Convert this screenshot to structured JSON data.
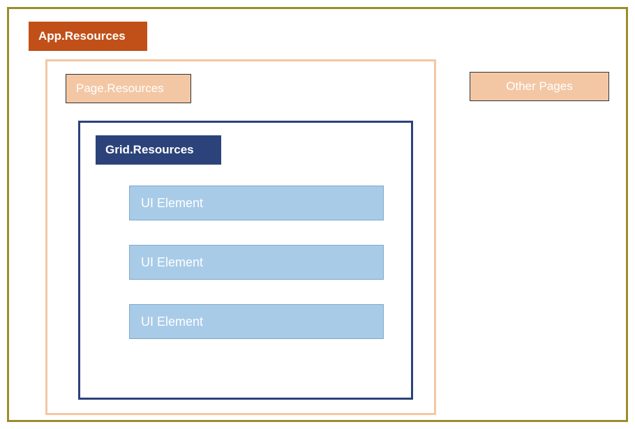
{
  "diagram": {
    "app_resources_label": "App.Resources",
    "page_resources_label": "Page.Resources",
    "other_pages_label": "Other Pages",
    "grid_resources_label": "Grid.Resources",
    "ui_elements": [
      "UI Element",
      "UI Element",
      "UI Element"
    ]
  },
  "colors": {
    "outer_border": "#9c8c2b",
    "app_bg": "#c05018",
    "page_border": "#f4c7a4",
    "page_label_bg": "#f4c7a4",
    "grid_border": "#2c427a",
    "grid_label_bg": "#2c427a",
    "ui_element_bg": "#a8cbe8"
  }
}
